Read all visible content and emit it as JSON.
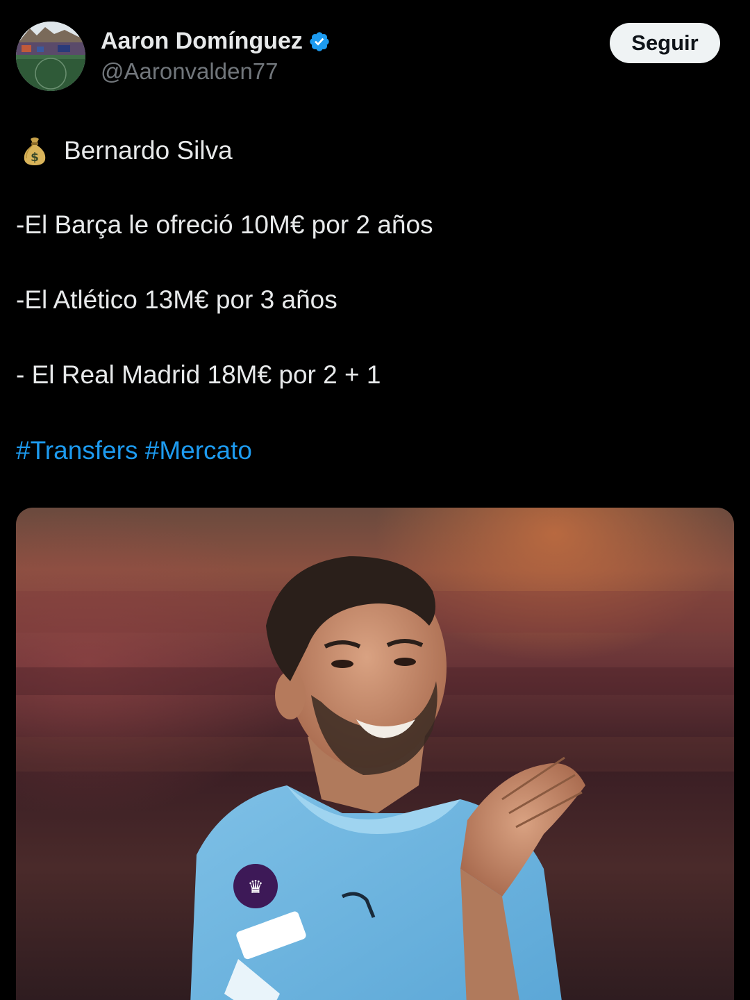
{
  "author": {
    "name": "Aaron Domínguez",
    "handle": "@Aaronvalden77",
    "avatar_icon": "stadium-photo-avatar",
    "verified_icon": "verified-badge-icon",
    "verified_color": "#1d9bf0"
  },
  "follow_button": {
    "label": "Seguir"
  },
  "tweet": {
    "title_emoji": "money-bag-icon",
    "title": "Bernardo Silva",
    "lines": [
      "-El Barça le ofreció 10M€ por 2 años",
      "-El Atlético 13M€ por 3 años",
      "- El Real Madrid 18M€ por 2 + 1"
    ],
    "hashtags": [
      "#Transfers",
      "#Mercato"
    ]
  },
  "media": {
    "kind": "photo"
  },
  "colors": {
    "background": "#000000",
    "text": "#e7e9ea",
    "secondary_text": "#71767b",
    "link": "#1d9bf0",
    "button_bg": "#eff3f4"
  }
}
